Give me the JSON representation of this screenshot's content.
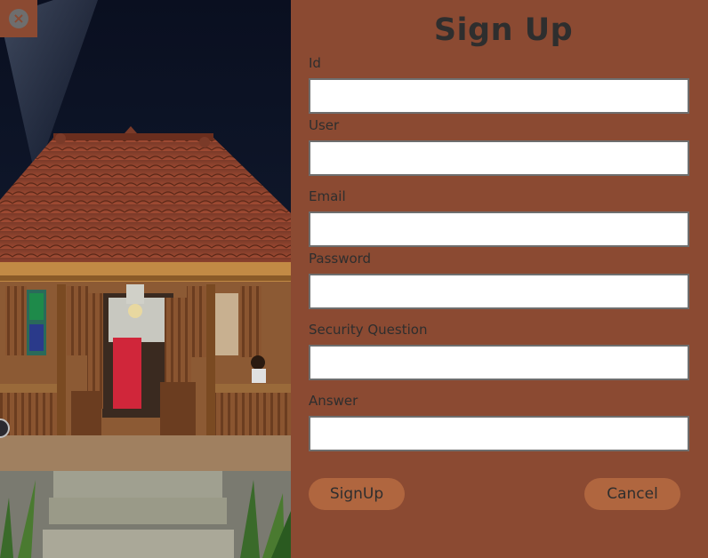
{
  "window": {
    "close_icon": "close-circle-icon",
    "close_glyph": "×"
  },
  "form": {
    "title": "Sign Up",
    "fields": [
      {
        "label": "Id",
        "value": "",
        "placeholder": ""
      },
      {
        "label": "User",
        "value": "",
        "placeholder": ""
      },
      {
        "label": "Email",
        "value": "",
        "placeholder": ""
      },
      {
        "label": "Password",
        "value": "",
        "placeholder": ""
      },
      {
        "label": "Security Question",
        "value": "",
        "placeholder": ""
      },
      {
        "label": "Answer",
        "value": "",
        "placeholder": ""
      }
    ],
    "signup_label": "SignUp",
    "cancel_label": "Cancel"
  },
  "colors": {
    "panel_bg": "#8b4a32",
    "button_bg": "#b0663f",
    "text": "#2e2e2e",
    "input_border": "#6e6e6e"
  }
}
